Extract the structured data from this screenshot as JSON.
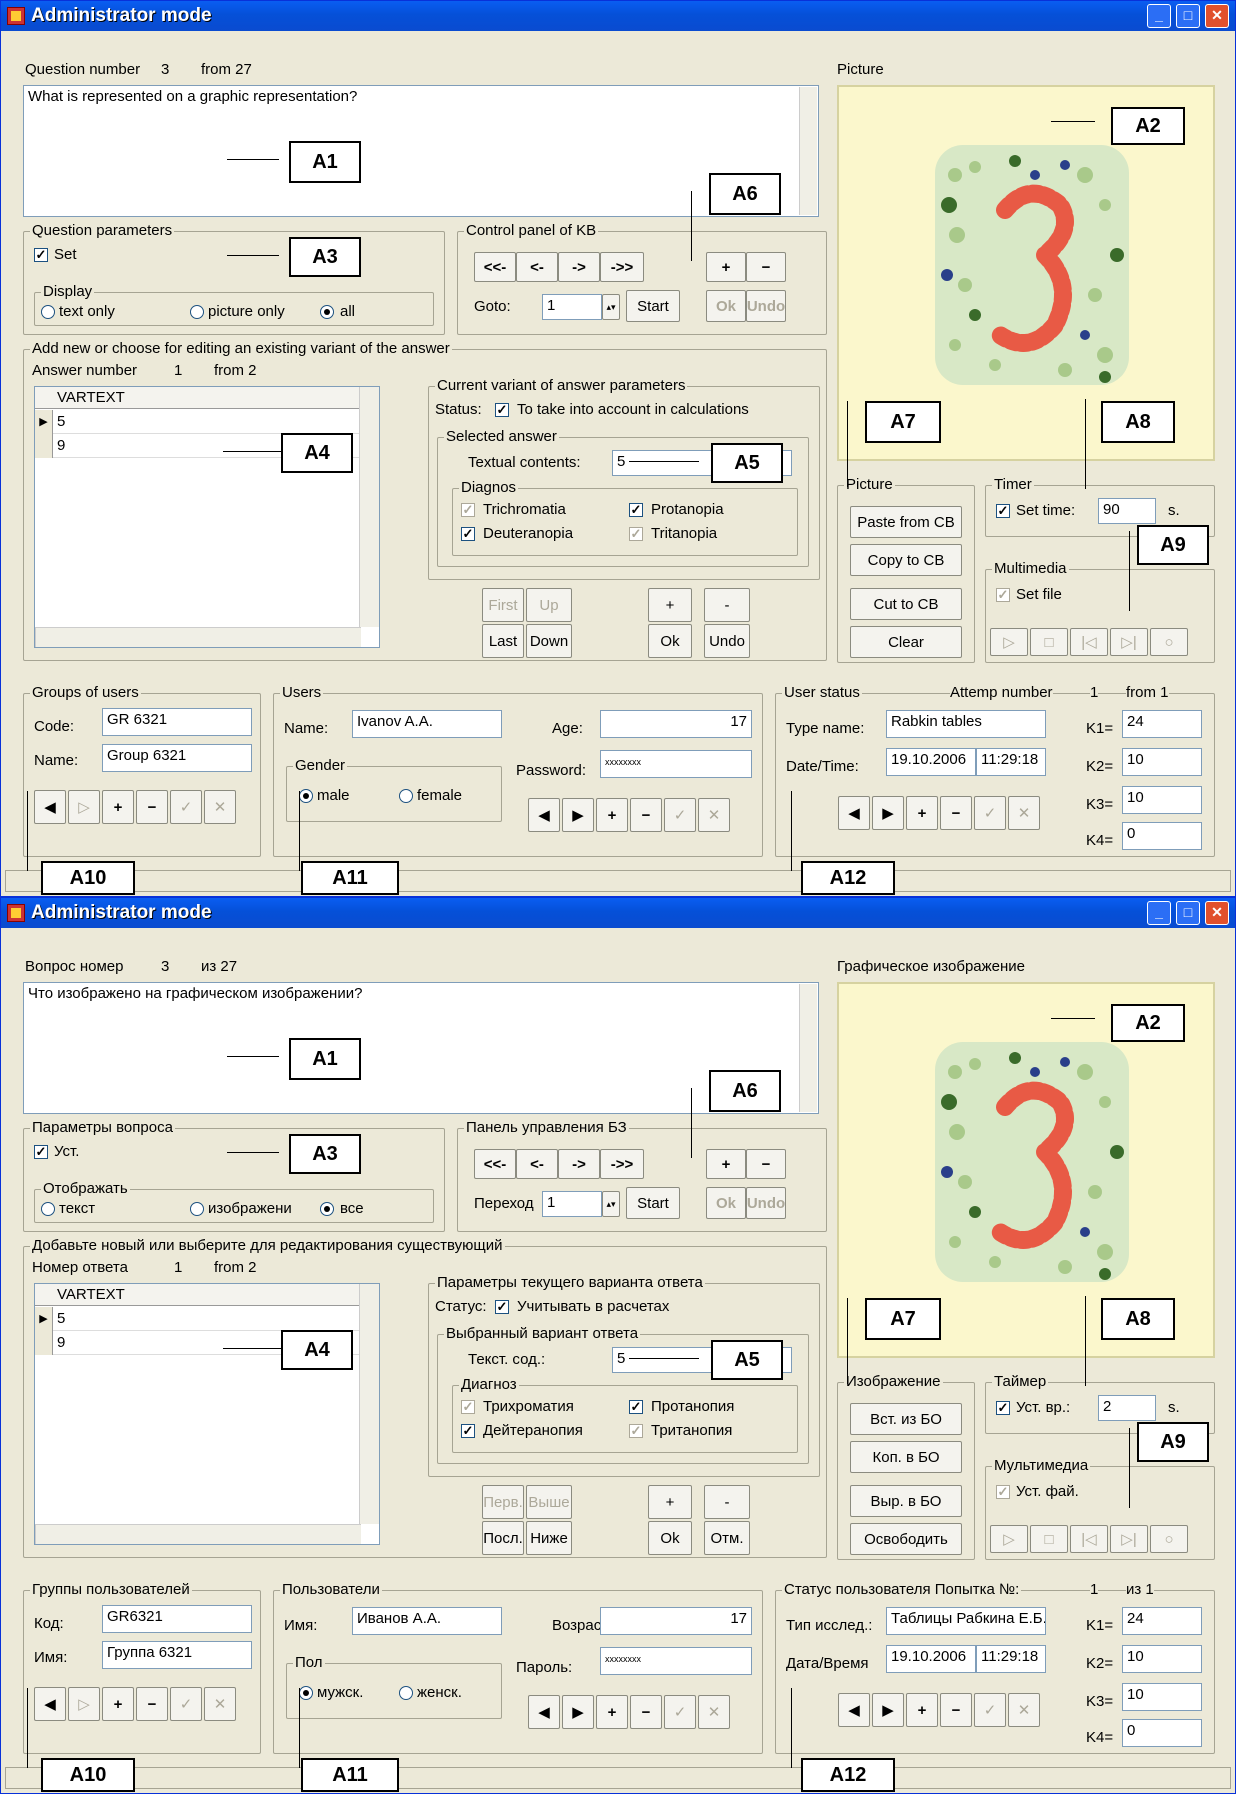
{
  "title": "Administrator mode",
  "colors": {
    "title_bar": "#0a5ef2",
    "window_bg": "#ece9d8",
    "picture_bg": "#fbf7cc"
  },
  "annotations": {
    "a1": "A1",
    "a2": "A2",
    "a3": "A3",
    "a4": "A4",
    "a5": "A5",
    "a6": "A6",
    "a7": "A7",
    "a8": "A8",
    "a9": "A9",
    "a10": "A10",
    "a11": "A11",
    "a12": "A12"
  },
  "windows": [
    {
      "question_label": "Question number",
      "question_num": "3",
      "question_from": "from 27",
      "question_text": "What is represented on a graphic representation?",
      "picture_title": "Picture",
      "qparams_title": "Question parameters",
      "set_label": "Set",
      "display_title": "Display",
      "r_text": "text only",
      "r_pic": "picture only",
      "r_all": "all",
      "kb_title": "Control panel of KB",
      "nav1": "<<-",
      "nav2": "<-",
      "nav3": "->",
      "nav4": "->>",
      "plus": "+",
      "minus": "−",
      "goto": "Goto:",
      "goto_val": "1",
      "start": "Start",
      "ok": "Ok",
      "undo": "Undo",
      "add_title": "Add new or choose for editing an existing variant of the answer",
      "ans_label": "Answer number",
      "ans_num": "1",
      "ans_from": "from 2",
      "grid_header": "VARTEXT",
      "rows": [
        "5",
        "9"
      ],
      "cur_title": "Current variant of answer parameters",
      "status_label": "Status:",
      "status_text": "To take into account in calculations",
      "sel_title": "Selected answer",
      "textual_label": "Textual contents:",
      "textual_val": "5",
      "diag_title": "Diagnos",
      "d1": "Trichromatia",
      "d2": "Protanopia",
      "d3": "Deuteranopia",
      "d4": "Tritanopia",
      "first": "First",
      "up": "Up",
      "last": "Last",
      "down": "Down",
      "ab_plus": "+",
      "ab_minus": "-",
      "ab_ok": "Ok",
      "ab_undo": "Undo",
      "pic_title": "Picture",
      "paste": "Paste from CB",
      "copy": "Copy to CB",
      "cut": "Cut to CB",
      "clear": "Clear",
      "timer_title": "Timer",
      "set_time": "Set time:",
      "time_val": "90",
      "sec": "s.",
      "mm_title": "Multimedia",
      "set_file": "Set file",
      "groups_title": "Groups of users",
      "code_label": "Code:",
      "code_val": "GR 6321",
      "name_label": "Name:",
      "name_val": "Group 6321",
      "users_title": "Users",
      "uname_label": "Name:",
      "uname_val": "Ivanov A.A.",
      "age_label": "Age:",
      "age_val": "17",
      "gender_title": "Gender",
      "male": "male",
      "female": "female",
      "pass_label": "Password:",
      "pass_val": "xxxxxxxx",
      "ustatus_title": "User status",
      "attempt_label": "Attemp number",
      "attempt_num": "1",
      "attempt_from": "from 1",
      "type_label": "Type name:",
      "type_val": "Rabkin tables",
      "date_label": "Date/Time:",
      "date_val": "19.10.2006",
      "time2_val": "11:29:18",
      "k1": "K1=",
      "k1v": "24",
      "k2": "K2=",
      "k2v": "10",
      "k3": "K3=",
      "k3v": "10",
      "k4": "K4=",
      "k4v": "0"
    },
    {
      "question_label": "Вопрос номер",
      "question_num": "3",
      "question_from": "из 27",
      "question_text": "Что изображено на графическом изображении?",
      "picture_title": "Графическое изображение",
      "qparams_title": "Параметры вопроса",
      "set_label": "Уст.",
      "display_title": "Отображать",
      "r_text": "текст",
      "r_pic": "изображени",
      "r_all": "все",
      "kb_title": "Панель управления БЗ",
      "nav1": "<<-",
      "nav2": "<-",
      "nav3": "->",
      "nav4": "->>",
      "plus": "+",
      "minus": "−",
      "goto": "Переход",
      "goto_val": "1",
      "start": "Start",
      "ok": "Ok",
      "undo": "Undo",
      "add_title": "Добавьте новый или выберите для редактирования существующий",
      "ans_label": "Номер ответа",
      "ans_num": "1",
      "ans_from": "from 2",
      "grid_header": "VARTEXT",
      "rows": [
        "5",
        "9"
      ],
      "cur_title": "Параметры текущего варианта ответа",
      "status_label": "Статус:",
      "status_text": "Учитывать в расчетах",
      "sel_title": "Выбранный вариант ответа",
      "textual_label": "Текст. сод.:",
      "textual_val": "5",
      "diag_title": "Диагноз",
      "d1": "Трихроматия",
      "d2": "Протанопия",
      "d3": "Дейтеранопия",
      "d4": "Тританопия",
      "first": "Перв.",
      "up": "Выше",
      "last": "Посл.",
      "down": "Ниже",
      "ab_plus": "+",
      "ab_minus": "-",
      "ab_ok": "Ok",
      "ab_undo": "Отм.",
      "pic_title": "Изображение",
      "paste": "Вст. из БО",
      "copy": "Коп. в БО",
      "cut": "Выр. в БО",
      "clear": "Освободить",
      "timer_title": "Таймер",
      "set_time": "Уст. вр.:",
      "time_val": "2",
      "sec": "s.",
      "mm_title": "Мультимедиа",
      "set_file": "Уст. фай.",
      "groups_title": "Группы пользователей",
      "code_label": "Код:",
      "code_val": "GR6321",
      "name_label": "Имя:",
      "name_val": "Группа 6321",
      "users_title": "Пользователи",
      "uname_label": "Имя:",
      "uname_val": "Иванов А.А.",
      "age_label": "Возраст:",
      "age_val": "17",
      "gender_title": "Пол",
      "male": "мужск.",
      "female": "женск.",
      "pass_label": "Пароль:",
      "pass_val": "xxxxxxxx",
      "ustatus_title": "Статус пользователя Попытка №:",
      "attempt_label": "",
      "attempt_num": "1",
      "attempt_from": "из 1",
      "type_label": "Тип исслед.:",
      "type_val": "Таблицы Рабкина Е.Б.",
      "date_label": "Дата/Время",
      "date_val": "19.10.2006",
      "time2_val": "11:29:18",
      "k1": "K1=",
      "k1v": "24",
      "k2": "K2=",
      "k2v": "10",
      "k3": "K3=",
      "k3v": "10",
      "k4": "K4=",
      "k4v": "0"
    }
  ]
}
